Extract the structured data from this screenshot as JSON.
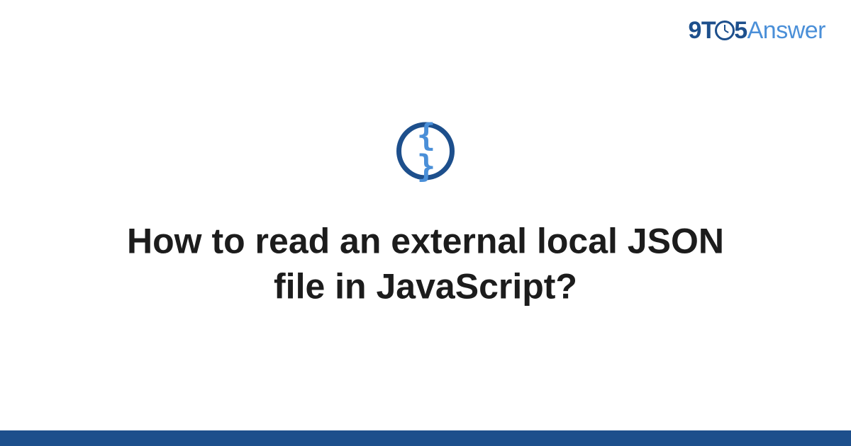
{
  "brand": {
    "nine": "9",
    "t": "T",
    "five": "5",
    "answer": "Answer"
  },
  "category": {
    "icon_name": "json-braces-icon",
    "glyph": "{ }"
  },
  "question": {
    "title": "How to read an external local JSON file in JavaScript?"
  },
  "colors": {
    "primary": "#1d4f8c",
    "accent": "#4a8fd8"
  }
}
